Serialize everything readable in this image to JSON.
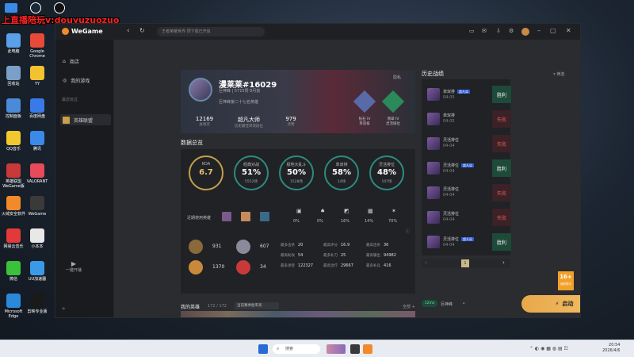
{
  "stream_banner": "上直播陪玩v:douyuzuozuo",
  "desktop_icons": [
    {
      "label": "此电脑",
      "color": "#5aa0e8"
    },
    {
      "label": "Google Chrome",
      "color": "#e84a3a"
    },
    {
      "label": "回收站",
      "color": "#7aa0c8"
    },
    {
      "label": "YY",
      "color": "#f2c230"
    },
    {
      "label": "控制面板",
      "color": "#4a8ad8"
    },
    {
      "label": "百度网盘",
      "color": "#3a7ae8"
    },
    {
      "label": "QQ音乐",
      "color": "#f2c830"
    },
    {
      "label": "腾讯",
      "color": "#3a8ae8"
    },
    {
      "label": "英雄联盟WeGame版",
      "color": "#c83a3a"
    },
    {
      "label": "VALORANT",
      "color": "#e84a5a"
    },
    {
      "label": "火绒安全软件",
      "color": "#f28a2a"
    },
    {
      "label": "WeGame",
      "color": "#3a3a3a"
    },
    {
      "label": "网易云音乐",
      "color": "#e23a3a"
    },
    {
      "label": "小本本",
      "color": "#e8e8e8"
    },
    {
      "label": "微信",
      "color": "#3ac23a"
    },
    {
      "label": "UU加速器",
      "color": "#3a9ae8"
    },
    {
      "label": "Microsoft Edge",
      "color": "#2a8ad8"
    },
    {
      "label": "剪映专业版",
      "color": "#1a1a1a"
    }
  ],
  "app": {
    "logo": "WeGame",
    "search_placeholder": "王者荣耀世界 预下载已开启",
    "nav": [
      "商店",
      "我的游戏"
    ],
    "recent_label": "最近玩过",
    "active_game": "英雄联盟",
    "bottom_btn": "一键开播"
  },
  "profile": {
    "name": "漫莱莱#16029",
    "server_info": "巨神峰 | 5715赞 8月前",
    "rank_text": "巨神峰第二十七名英雄",
    "hidden_label": "隐私",
    "stats": [
      {
        "value": "12169",
        "label": "总场次"
      },
      {
        "value": "超凡大师",
        "label": "历史最佳单双段位"
      },
      {
        "value": "979",
        "label": "点赞"
      }
    ],
    "rank_badges": [
      {
        "tier": "钻石 IV",
        "mode": "单双排"
      },
      {
        "tier": "翡翠 IV",
        "mode": "灵活排位"
      }
    ]
  },
  "overview": {
    "title": "数据总览",
    "rings": [
      {
        "label": "KDA",
        "value": "6.7",
        "sub": "",
        "color": "#c4a04a"
      },
      {
        "label": "经典对战",
        "value": "51%",
        "sub": "5552场",
        "color": "#2e8b80"
      },
      {
        "label": "极地大乱斗",
        "value": "50%",
        "sub": "1528场",
        "color": "#2e8b80"
      },
      {
        "label": "单双排",
        "value": "58%",
        "sub": "14场",
        "color": "#2e8b80"
      },
      {
        "label": "灵活排位",
        "value": "48%",
        "sub": "107场",
        "color": "#2e8b80"
      }
    ],
    "recent_heroes_label": "近期使用英雄",
    "position_pcts": [
      "0%",
      "0%",
      "16%",
      "14%",
      "70%"
    ],
    "medals": [
      {
        "value": "931"
      },
      {
        "value": "607"
      },
      {
        "value": "1370"
      },
      {
        "value": "34"
      }
    ],
    "details": [
      {
        "label": "最多击杀",
        "value": "20"
      },
      {
        "label": "最高评分",
        "value": "16.9"
      },
      {
        "label": "最高连杀",
        "value": "36"
      },
      {
        "label": "最高助攻",
        "value": "54"
      },
      {
        "label": "最多补刀",
        "value": "25"
      },
      {
        "label": "最高输出",
        "value": "94982"
      },
      {
        "label": "最多承受",
        "value": "122327"
      },
      {
        "label": "最高治疗",
        "value": "29667"
      },
      {
        "label": "最多补兵",
        "value": "416"
      }
    ]
  },
  "heroes": {
    "title": "我的英雄",
    "count": "172 / 172",
    "filter": "当前赛季胜率高",
    "expand": "全部 +"
  },
  "history": {
    "title": "历史战绩",
    "filter": "筛选",
    "matches": [
      {
        "mode": "单双排",
        "date": "04-05",
        "result": "胜利",
        "tag": "超凡局"
      },
      {
        "mode": "单双排",
        "date": "04-05",
        "result": "失败",
        "tag": ""
      },
      {
        "mode": "灵活排位",
        "date": "04-04",
        "result": "失败",
        "tag": ""
      },
      {
        "mode": "灵活排位",
        "date": "04-04",
        "result": "胜利",
        "tag": "超凡局"
      },
      {
        "mode": "灵活排位",
        "date": "04-04",
        "result": "失败",
        "tag": ""
      },
      {
        "mode": "灵活排位",
        "date": "04-04",
        "result": "失败",
        "tag": ""
      },
      {
        "mode": "灵活排位",
        "date": "04-04",
        "result": "胜利",
        "tag": "超凡局"
      }
    ],
    "page": "1"
  },
  "launch": {
    "ping": "12ms",
    "server": "巨神峰",
    "button": "启动"
  },
  "age_badge": "16+",
  "age_badge_sub": "适龄提示",
  "taskbar": {
    "search": "搜索",
    "time": "20:54",
    "date": "2026/4/6"
  }
}
